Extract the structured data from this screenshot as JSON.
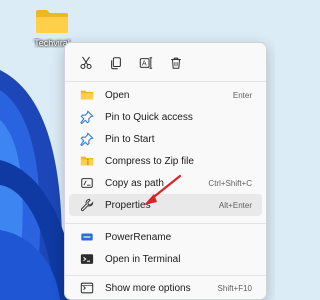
{
  "desktop": {
    "icon": {
      "name": "folder-icon",
      "label": "Techviral"
    }
  },
  "menu": {
    "toolbar": [
      {
        "name": "cut-icon",
        "icon": "scissors"
      },
      {
        "name": "copy-icon",
        "icon": "copy"
      },
      {
        "name": "rename-icon",
        "icon": "rename"
      },
      {
        "name": "delete-icon",
        "icon": "trash"
      }
    ],
    "items": [
      {
        "label": "Open",
        "shortcut": "Enter",
        "icon": "folder-icon"
      },
      {
        "label": "Pin to Quick access",
        "shortcut": "",
        "icon": "pin-icon"
      },
      {
        "label": "Pin to Start",
        "shortcut": "",
        "icon": "pin-icon"
      },
      {
        "label": "Compress to Zip file",
        "shortcut": "",
        "icon": "zip-icon"
      },
      {
        "label": "Copy as path",
        "shortcut": "Ctrl+Shift+C",
        "icon": "copy-path-icon"
      },
      {
        "label": "Properties",
        "shortcut": "Alt+Enter",
        "icon": "wrench-icon"
      },
      {
        "label": "PowerRename",
        "shortcut": "",
        "icon": "power-rename-icon"
      },
      {
        "label": "Open in Terminal",
        "shortcut": "",
        "icon": "terminal-icon"
      },
      {
        "label": "Show more options",
        "shortcut": "Shift+F10",
        "icon": "more-options-icon"
      }
    ]
  },
  "colors": {
    "accent": "#1f6fd1",
    "arrow": "#d8232a"
  }
}
